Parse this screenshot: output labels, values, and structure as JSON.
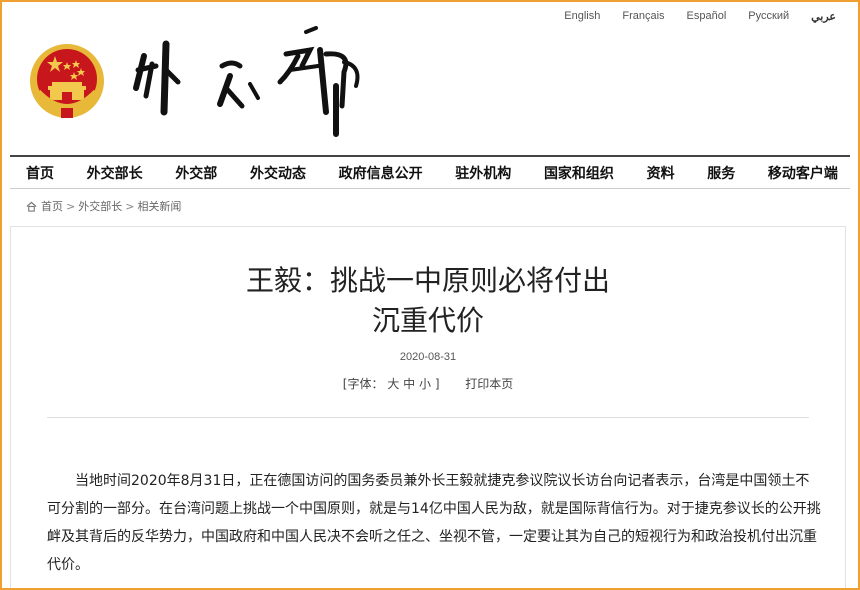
{
  "languages": [
    "English",
    "Français",
    "Español",
    "Русский",
    "عربي"
  ],
  "nav": [
    "首页",
    "外交部长",
    "外交部",
    "外交动态",
    "政府信息公开",
    "驻外机构",
    "国家和组织",
    "资料",
    "服务",
    "移动客户端"
  ],
  "breadcrumb": {
    "home": "首页",
    "sep": ">",
    "level2": "外交部长",
    "level3": "相关新闻"
  },
  "article": {
    "title_line1": "王毅：挑战一中原则必将付出",
    "title_line2": "沉重代价",
    "date": "2020-08-31",
    "font_label": "[字体：",
    "font_large": "大",
    "font_medium": "中",
    "font_small": "小",
    "font_close": "]",
    "print": "打印本页",
    "body": "当地时间2020年8月31日，正在德国访问的国务委员兼外长王毅就捷克参议院议长访台向记者表示，台湾是中国领土不可分割的一部分。在台湾问题上挑战一个中国原则，就是与14亿中国人民为敌，就是国际背信行为。对于捷克参议长的公开挑衅及其背后的反华势力，中国政府和中国人民决不会听之任之、坐视不管，一定要让其为自己的短视行为和政治投机付出沉重代价。"
  },
  "colors": {
    "frame": "#f0a030",
    "emblem_red": "#c8161d",
    "emblem_gold": "#e8b838"
  }
}
